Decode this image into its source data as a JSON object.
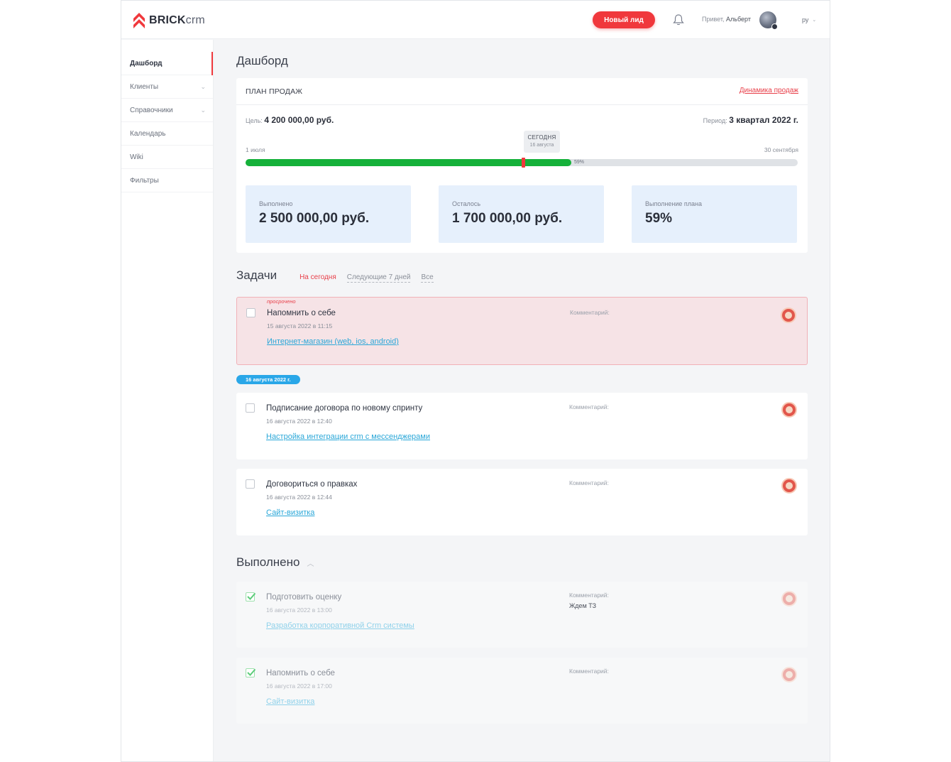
{
  "header": {
    "logo_bold": "BRICK",
    "logo_light": "crm",
    "new_lead": "Новый лид",
    "greeting": "Привет,",
    "user_name": "Альберт",
    "lang": "ру"
  },
  "sidebar": {
    "items": [
      {
        "label": "Дашборд"
      },
      {
        "label": "Клиенты"
      },
      {
        "label": "Справочники"
      },
      {
        "label": "Календарь"
      },
      {
        "label": "Wiki"
      },
      {
        "label": "Фильтры"
      }
    ]
  },
  "page_title": "Дашборд",
  "plan": {
    "title": "ПЛАН ПРОДАЖ",
    "link": "Динамика продаж",
    "goal_label": "Цель:",
    "goal_value": "4 200 000,00 руб.",
    "period_label": "Период:",
    "period_value": "3 квартал 2022 г.",
    "start": "1 июля",
    "end": "30 сентября",
    "today_label": "СЕГОДНЯ",
    "today_date": "16 августа",
    "progress_pct_text": "59%",
    "progress": 0.59,
    "today_position": 0.5,
    "stats": [
      {
        "label": "Выполнено",
        "value": "2 500 000,00 руб."
      },
      {
        "label": "Осталось",
        "value": "1 700 000,00 руб."
      },
      {
        "label": "Выполнение плана",
        "value": "59%"
      }
    ]
  },
  "tasks": {
    "title": "Задачи",
    "tabs": [
      "На сегодня",
      "Следующие 7 дней",
      "Все"
    ],
    "overdue_label": "просрочено",
    "date_pill": "16 августа 2022 г.",
    "comment_label": "Комментарий:",
    "items": [
      {
        "name": "Напомнить о себе",
        "date": "15 августа 2022 в 11:15",
        "project": "Интернет-магазин (web, ios, android)"
      },
      {
        "name": "Подписание договора по новому спринту",
        "date": "16 августа 2022 в 12:40",
        "project": "Настройка интеграции crm с мессенджерами"
      },
      {
        "name": "Договориться о правках",
        "date": "16 августа 2022 в 12:44",
        "project": "Сайт-визитка"
      }
    ]
  },
  "done": {
    "title": "Выполнено",
    "items": [
      {
        "name": "Подготовить оценку",
        "date": "16 августа 2022 в 13:00",
        "project": "Разработка корпоративной Crm системы",
        "comment": "Ждем ТЗ"
      },
      {
        "name": "Напомнить о себе",
        "date": "16 августа 2022 в 17:00",
        "project": "Сайт-визитка",
        "comment": ""
      }
    ]
  },
  "colors": {
    "accent": "#f0383c",
    "progress": "#15b13a",
    "link": "#2aa7d8",
    "stat_bg": "#e6f0fc"
  }
}
